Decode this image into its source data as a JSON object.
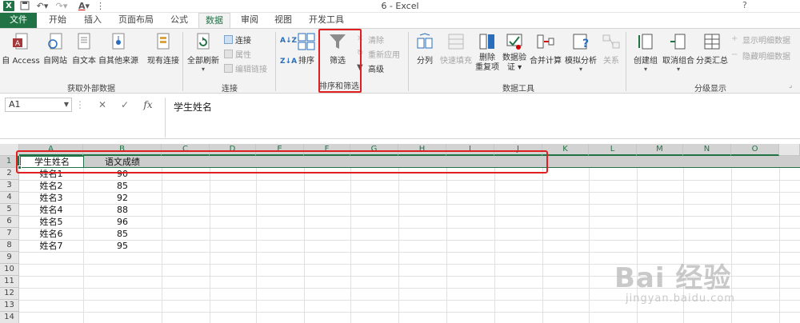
{
  "window": {
    "title": "6 - Excel",
    "help": "?"
  },
  "tabs": [
    {
      "label": "文件"
    },
    {
      "label": "开始"
    },
    {
      "label": "插入"
    },
    {
      "label": "页面布局"
    },
    {
      "label": "公式"
    },
    {
      "label": "数据"
    },
    {
      "label": "审阅"
    },
    {
      "label": "视图"
    },
    {
      "label": "开发工具"
    }
  ],
  "ribbon": {
    "external": {
      "access": "自 Access",
      "web": "自网站",
      "text": "自文本",
      "other": "自其他来源",
      "existing": "现有连接",
      "group": "获取外部数据"
    },
    "connections": {
      "refresh_all": "全部刷新",
      "connections": "连接",
      "properties": "属性",
      "edit_links": "编辑链接",
      "group": "连接"
    },
    "sort_filter": {
      "az": "A↓Z",
      "za": "Z↓A",
      "sort": "排序",
      "filter": "筛选",
      "clear": "清除",
      "reapply": "重新应用",
      "advanced": "高级",
      "group": "排序和筛选"
    },
    "data_tools": {
      "text_to_columns": "分列",
      "flash_fill": "快速填充",
      "remove_dup_1": "删除",
      "remove_dup_2": "重复项",
      "validation_1": "数据验",
      "validation_2": "证",
      "consolidate": "合并计算",
      "what_if": "模拟分析",
      "relationships": "关系",
      "group": "数据工具"
    },
    "outline": {
      "group_btn": "创建组",
      "ungroup": "取消组合",
      "subtotal": "分类汇总",
      "show_detail": "显示明细数据",
      "hide_detail": "隐藏明细数据",
      "group": "分级显示"
    }
  },
  "formula_bar": {
    "name_box": "A1",
    "cancel": "✕",
    "enter": "✓",
    "fx": "fx",
    "content": "学生姓名"
  },
  "columns": [
    "A",
    "B",
    "C",
    "D",
    "E",
    "F",
    "G",
    "H",
    "I",
    "J",
    "K",
    "L",
    "M",
    "N",
    "O"
  ],
  "rows": [
    "1",
    "2",
    "3",
    "4",
    "5",
    "6",
    "7",
    "8",
    "9",
    "10",
    "11",
    "12",
    "13",
    "14"
  ],
  "sheet": {
    "header": {
      "name": "学生姓名",
      "score": "语文成绩"
    },
    "records": [
      {
        "name": "姓名1",
        "score": "90"
      },
      {
        "name": "姓名2",
        "score": "85"
      },
      {
        "name": "姓名3",
        "score": "92"
      },
      {
        "name": "姓名4",
        "score": "88"
      },
      {
        "name": "姓名5",
        "score": "96"
      },
      {
        "name": "姓名6",
        "score": "85"
      },
      {
        "name": "姓名7",
        "score": "95"
      }
    ]
  },
  "watermark": {
    "main": "Bai 经验",
    "sub": "jingyan.baidu.com"
  },
  "colors": {
    "excel_green": "#217346",
    "highlight_red": "#e02020"
  }
}
